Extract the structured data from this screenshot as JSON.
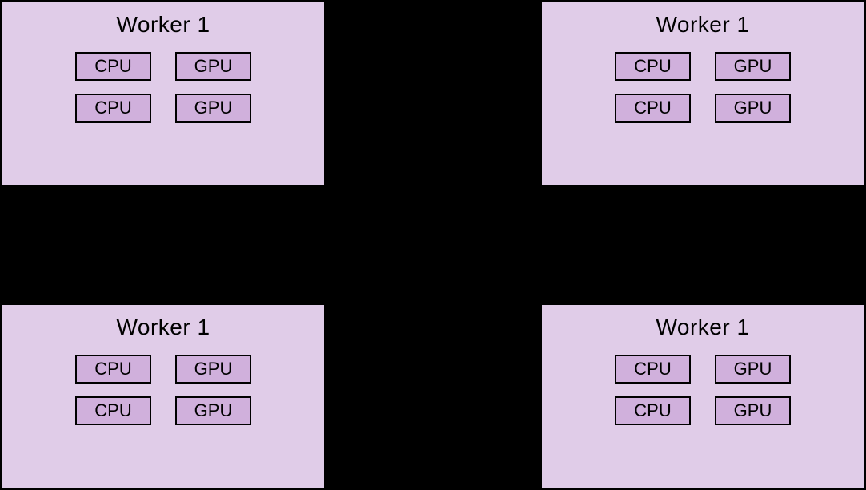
{
  "workers": [
    {
      "title": "Worker 1",
      "units": [
        "CPU",
        "GPU",
        "CPU",
        "GPU"
      ]
    },
    {
      "title": "Worker 1",
      "units": [
        "CPU",
        "GPU",
        "CPU",
        "GPU"
      ]
    },
    {
      "title": "Worker 1",
      "units": [
        "CPU",
        "GPU",
        "CPU",
        "GPU"
      ]
    },
    {
      "title": "Worker 1",
      "units": [
        "CPU",
        "GPU",
        "CPU",
        "GPU"
      ]
    }
  ]
}
